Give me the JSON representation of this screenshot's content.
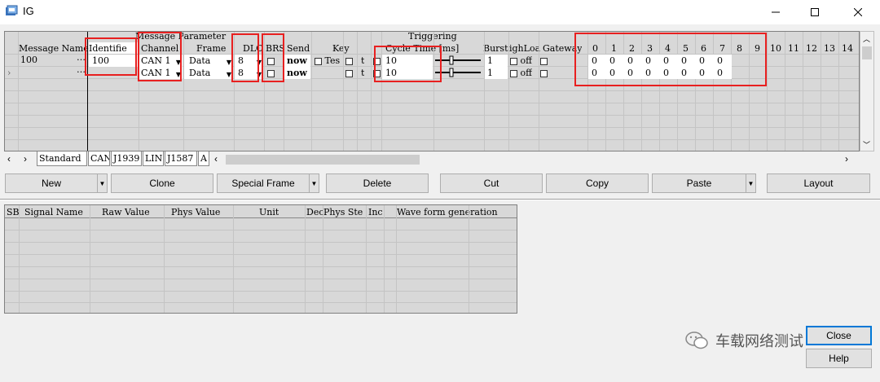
{
  "window": {
    "title": "IG"
  },
  "top_header": {
    "group_message": "Message Parameter",
    "group_triggering": "Triggering"
  },
  "columns": [
    "Message Name",
    "Identifier",
    "Channel",
    "Frame",
    "DLC",
    "BRS",
    "Send",
    "Key",
    "Cycle Time [ms]",
    "Burst",
    "HighLoad",
    "Gateway",
    "0",
    "1",
    "2",
    "3",
    "4",
    "5",
    "6",
    "7",
    "8",
    "9",
    "10",
    "11",
    "12",
    "13",
    "14"
  ],
  "column_display": {
    "identifier": "Identifie",
    "burst": "Burst",
    "highload": "ighLoa",
    "gateway": "Gateway"
  },
  "rows": [
    {
      "name": "100",
      "identifier": "100",
      "channel": "CAN 1",
      "frame": "Data",
      "dlc": "8",
      "send": "now",
      "key": "Tes",
      "key2": "t",
      "cycle": "10",
      "burst": "1",
      "highload": "off",
      "bytes": [
        "0",
        "0",
        "0",
        "0",
        "0",
        "0",
        "0",
        "0"
      ]
    },
    {
      "name": "",
      "identifier": "",
      "channel": "CAN 1",
      "frame": "Data",
      "dlc": "8",
      "send": "now",
      "key": "",
      "key2": "t",
      "cycle": "10",
      "burst": "1",
      "highload": "off",
      "bytes": [
        "0",
        "0",
        "0",
        "0",
        "0",
        "0",
        "0",
        "0"
      ]
    }
  ],
  "tabs": [
    "Standard",
    "CAN",
    "J1939",
    "LIN",
    "J1587",
    "A"
  ],
  "buttons": {
    "new": "New",
    "clone": "Clone",
    "special_frame": "Special Frame",
    "delete": "Delete",
    "cut": "Cut",
    "copy": "Copy",
    "paste": "Paste",
    "layout": "Layout",
    "close": "Close",
    "help": "Help"
  },
  "signal_columns": [
    "SB",
    "Signal Name",
    "Raw Value",
    "Phys Value",
    "Unit",
    "Dec",
    "Phys Step",
    "Inc",
    "",
    "Wave form generation"
  ],
  "signal_display": {
    "phys_step": "Phys Ste"
  },
  "watermark": "车载网络测试",
  "accent": "#e82020"
}
